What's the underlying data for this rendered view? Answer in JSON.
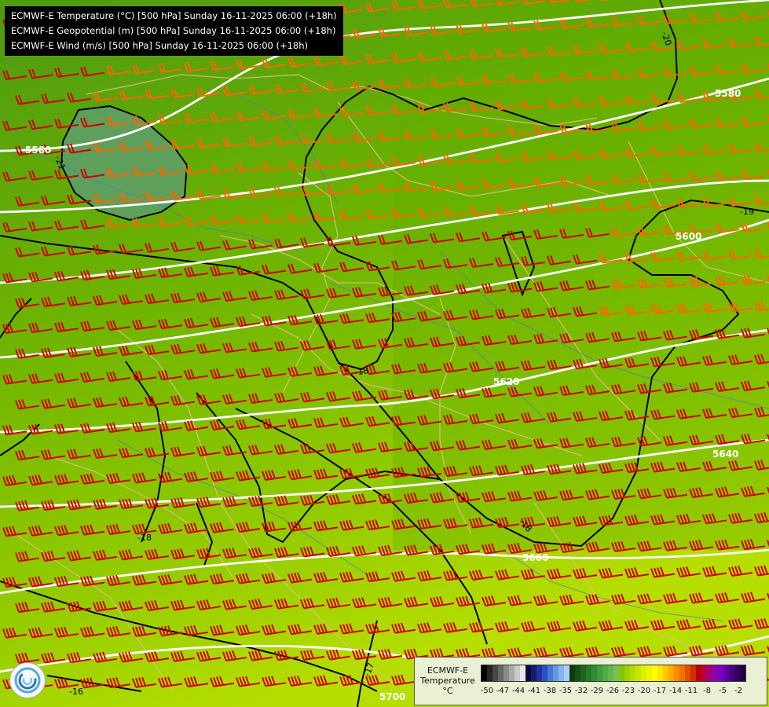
{
  "titles": [
    "ECMWF-E Temperature (°C) [500 hPa] Sunday 16-11-2025 06:00 (+18h)",
    "ECMWF-E Geopotential (m) [500 hPa] Sunday 16-11-2025 06:00 (+18h)",
    "ECMWF-E Wind (m/s) [500 hPa] Sunday 16-11-2025 06:00 (+18h)"
  ],
  "legend": {
    "line1": "ECMWF-E",
    "line2": "Temperature",
    "unit": "°C",
    "tick_labels": [
      "-50",
      "-47",
      "-44",
      "-41",
      "-38",
      "-35",
      "-32",
      "-29",
      "-26",
      "-23",
      "-20",
      "-17",
      "-14",
      "-11",
      "-8",
      "-5",
      "-2"
    ],
    "colors": [
      "#000000",
      "#262626",
      "#474747",
      "#686868",
      "#8a8a8a",
      "#aaaaaa",
      "#cacaca",
      "#e8e8e8",
      "#0a0a3c",
      "#141e6e",
      "#1e32a0",
      "#2d50be",
      "#4678d2",
      "#6496e1",
      "#87b4ec",
      "#aad0f5",
      "#0c3c0c",
      "#145014",
      "#1e641e",
      "#287828",
      "#328c32",
      "#3ca03c",
      "#50aa46",
      "#64b450",
      "#78c05a",
      "#82c800",
      "#a0d200",
      "#b4dc00",
      "#c8e600",
      "#dcf000",
      "#f0f500",
      "#ffff00",
      "#ffe600",
      "#ffc800",
      "#ffaa00",
      "#ff8c00",
      "#f07000",
      "#e05000",
      "#d03000",
      "#c00000",
      "#b00040",
      "#a00080",
      "#9000b0",
      "#7800c8",
      "#6000a0",
      "#480080",
      "#300060",
      "#200040"
    ]
  },
  "isohypses_m": [
    {
      "label": "5580",
      "value": 5580
    },
    {
      "label": "5580",
      "value": 5580
    },
    {
      "label": "5600",
      "value": 5600
    },
    {
      "label": "5620",
      "value": 5620
    },
    {
      "label": "5640",
      "value": 5640
    },
    {
      "label": "5660",
      "value": 5660
    },
    {
      "label": "5700",
      "value": 5700
    }
  ],
  "isotherm_labels": [
    "-20",
    "-21",
    "-19",
    "-18",
    "-18",
    "-18",
    "-17",
    "-16"
  ],
  "colors": {
    "barb_cold": "#ff6600",
    "barb_warm": "#d40000",
    "isohypse": "#ffffff",
    "isotherm": "#000000",
    "border": "#e0c080",
    "river": "#4a80b8"
  },
  "icons": {
    "logo": "ecmwf-logo-icon"
  }
}
